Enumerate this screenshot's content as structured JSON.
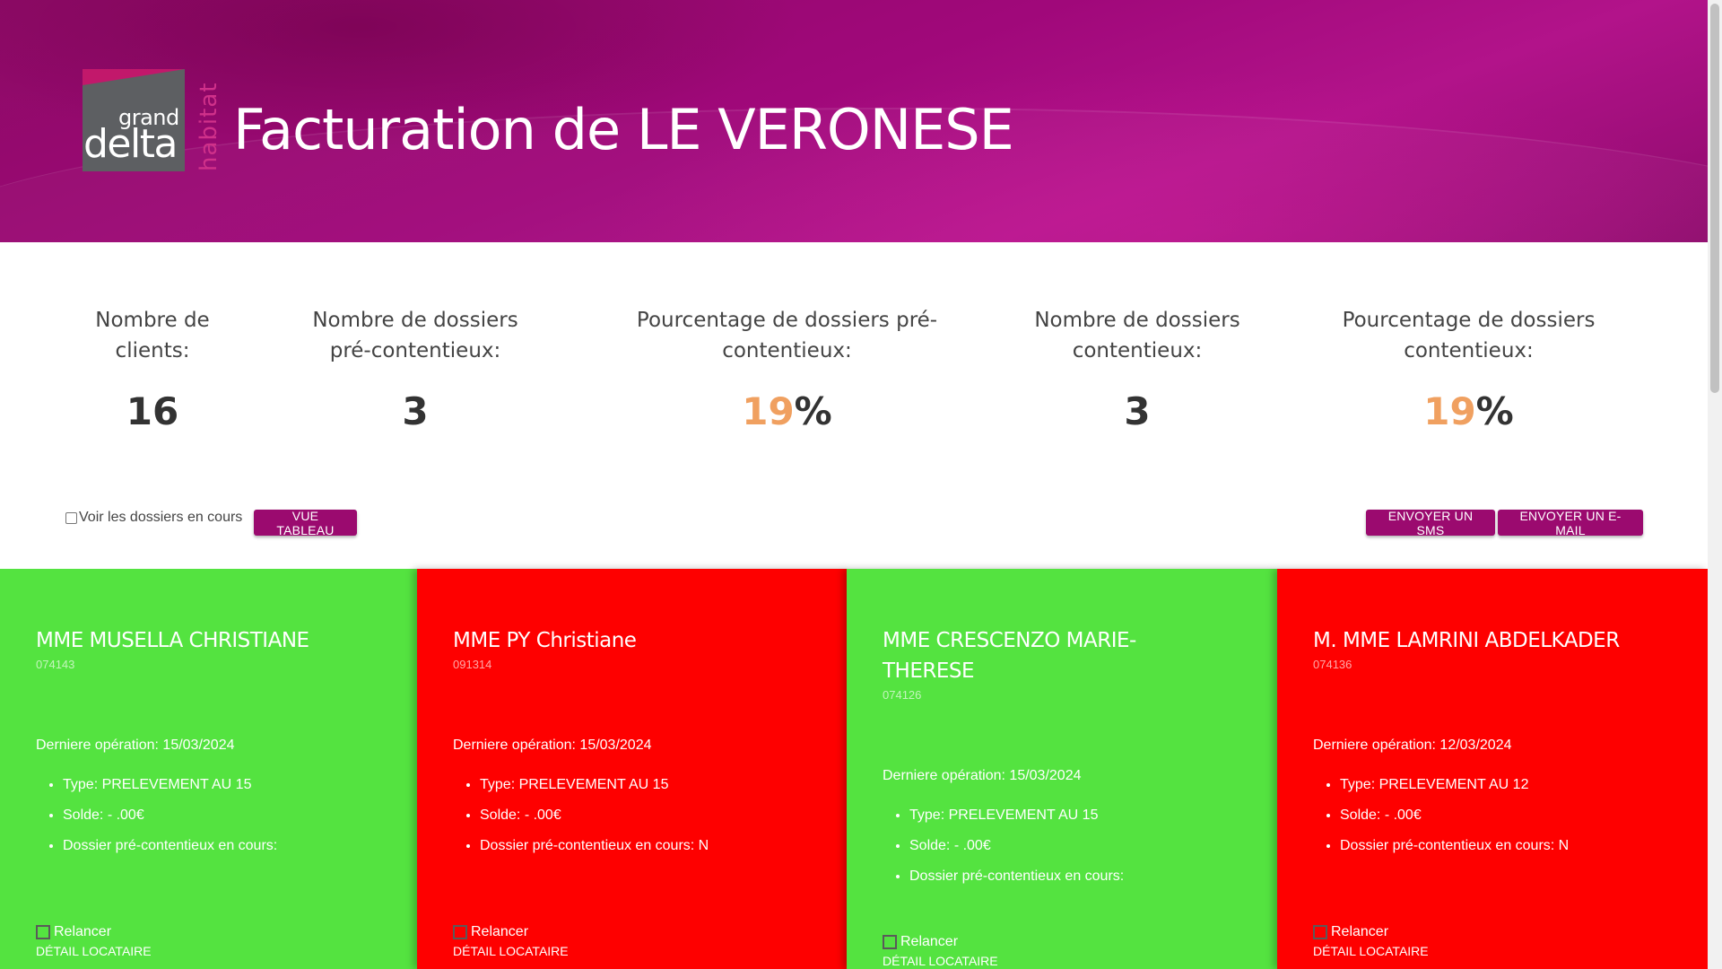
{
  "header": {
    "title": "Facturation de LE VERONESE",
    "logo": {
      "line1": "grand",
      "line2": "delta",
      "line3": "habitat"
    }
  },
  "stats": [
    {
      "label": "Nombre de clients:",
      "value": "16",
      "accent": "",
      "suffix": ""
    },
    {
      "label": "Nombre de dossiers pré-contentieux:",
      "value": "3",
      "accent": "",
      "suffix": ""
    },
    {
      "label": "Pourcentage de dossiers pré-contentieux:",
      "value": "",
      "accent": "19",
      "suffix": "%"
    },
    {
      "label": "Nombre de dossiers contentieux:",
      "value": "3",
      "accent": "",
      "suffix": ""
    },
    {
      "label": "Pourcentage de dossiers contentieux:",
      "value": "",
      "accent": "19",
      "suffix": "%"
    }
  ],
  "controls": {
    "voir_label": "Voir les dossiers en cours",
    "vue_tableau": "VUE TABLEAU",
    "sms": "ENVOYER UN SMS",
    "email": "ENVOYER UN E-MAIL"
  },
  "colors": {
    "brand": "#9b0a6f",
    "accent": "#f0a060",
    "card_green": "#54e340",
    "card_red": "#fe0000"
  },
  "cards": [
    {
      "name": "MME MUSELLA CHRISTIANE",
      "code": "074143",
      "status": "green",
      "last_op": "Derniere opération: 15/03/2024",
      "type": "Type: PRELEVEMENT AU 15",
      "solde": "Solde: - .00€",
      "dossier": "Dossier pré-contentieux en cours:",
      "relancer": "Relancer",
      "detail": "DÉTAIL LOCATAIRE"
    },
    {
      "name": "MME PY Christiane",
      "code": "091314",
      "status": "red",
      "last_op": "Derniere opération: 15/03/2024",
      "type": "Type: PRELEVEMENT AU 15",
      "solde": "Solde: - .00€",
      "dossier": "Dossier pré-contentieux en cours: N",
      "relancer": "Relancer",
      "detail": "DÉTAIL LOCATAIRE"
    },
    {
      "name": "MME CRESCENZO MARIE-THERESE",
      "code": "074126",
      "status": "green",
      "last_op": "Derniere opération: 15/03/2024",
      "type": "Type: PRELEVEMENT AU 15",
      "solde": "Solde: - .00€",
      "dossier": "Dossier pré-contentieux en cours:",
      "relancer": "Relancer",
      "detail": "DÉTAIL LOCATAIRE"
    },
    {
      "name": "M. MME LAMRINI ABDELKADER",
      "code": "074136",
      "status": "red",
      "last_op": "Derniere opération: 12/03/2024",
      "type": "Type: PRELEVEMENT AU 12",
      "solde": "Solde: - .00€",
      "dossier": "Dossier pré-contentieux en cours: N",
      "relancer": "Relancer",
      "detail": "DÉTAIL LOCATAIRE"
    }
  ]
}
